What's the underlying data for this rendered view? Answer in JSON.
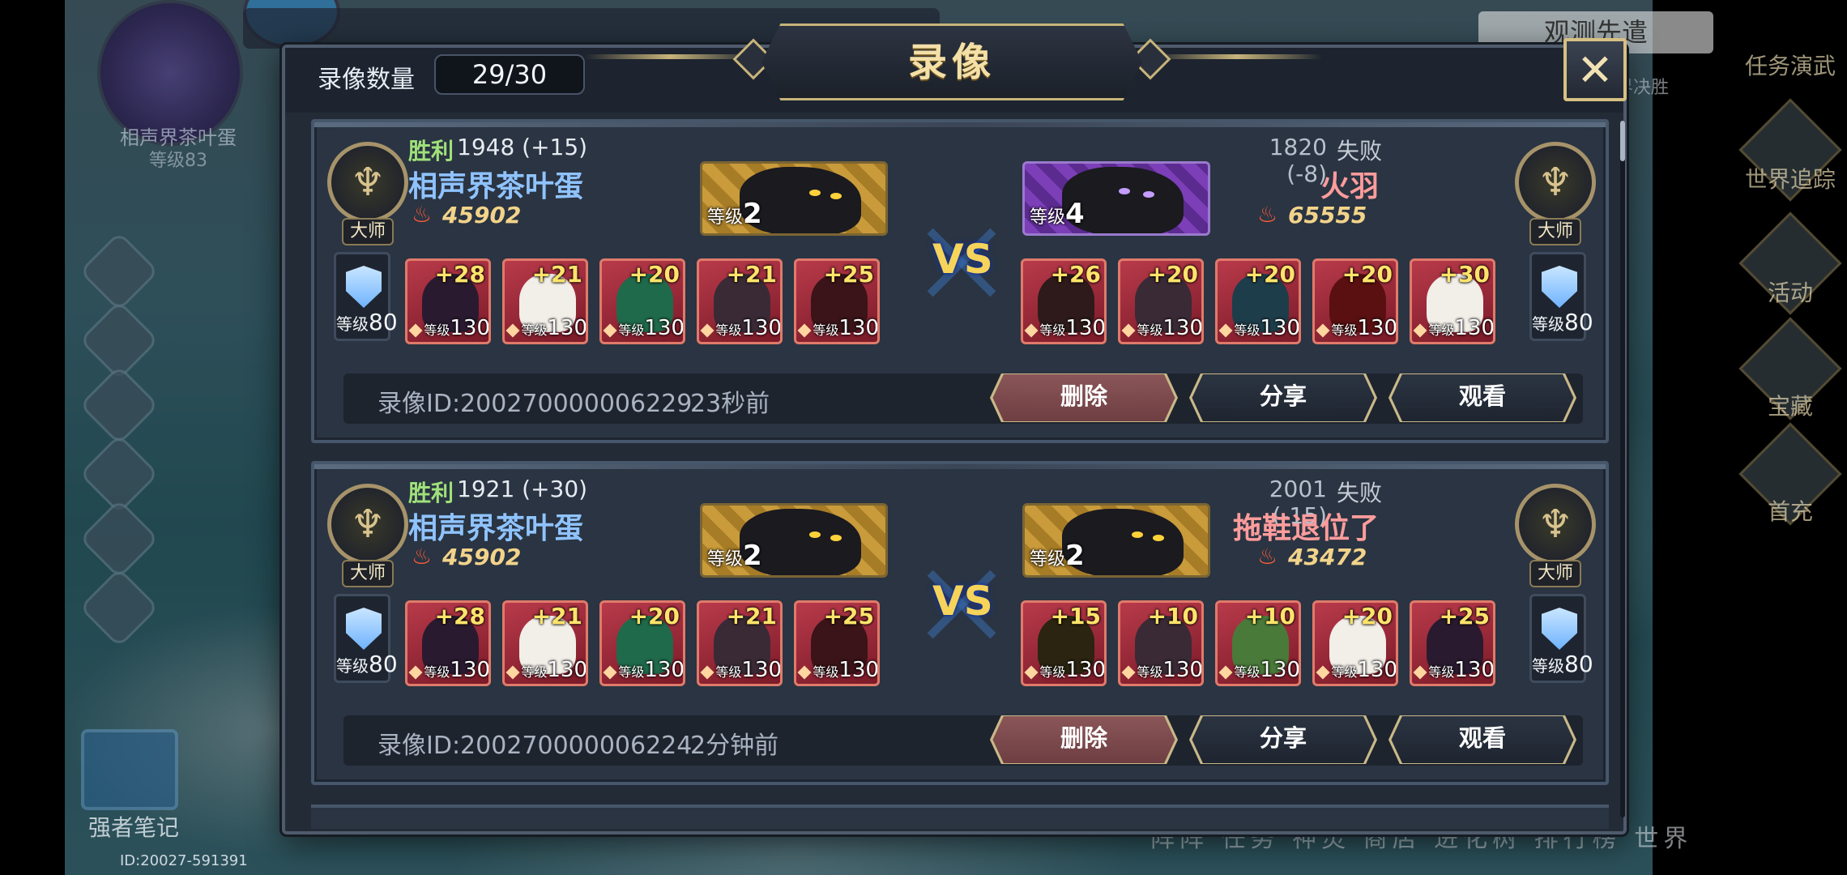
{
  "background": {
    "player_name": "相声界茶叶蛋",
    "player_sub": "等级83",
    "note_label": "强者笔记",
    "uid": "ID:20027-591391",
    "search_text": "观测先遣",
    "search_sub": "古世界决胜",
    "right_items": [
      "任务演武",
      "世界追踪",
      "活动",
      "宝藏",
      "首充"
    ],
    "bottom_nav": "阵阵  任务  神灵  商店  进化树  排行榜  世界"
  },
  "modal": {
    "title": "录像",
    "count_label": "录像数量",
    "count_value": "29/30",
    "close_icon": "close-x-icon",
    "accent_gold": "#c8b47a"
  },
  "records": [
    {
      "left": {
        "result": "胜利",
        "score": "1948 (+15)",
        "name": "相声界茶叶蛋",
        "power": "45902",
        "rank": "大师",
        "pet_level_label": "等级",
        "pet_level": "2",
        "pet_style": "gold",
        "shield_level_label": "等级",
        "shield_level": "80",
        "heroes": [
          {
            "plus": "+28",
            "level_label": "等级",
            "level": "130"
          },
          {
            "plus": "+21",
            "level_label": "等级",
            "level": "130"
          },
          {
            "plus": "+20",
            "level_label": "等级",
            "level": "130"
          },
          {
            "plus": "+21",
            "level_label": "等级",
            "level": "130"
          },
          {
            "plus": "+25",
            "level_label": "等级",
            "level": "130"
          }
        ]
      },
      "right": {
        "result": "失败",
        "score": "1820 (-8)",
        "name": "火羽",
        "power": "65555",
        "rank": "大师",
        "pet_level_label": "等级",
        "pet_level": "4",
        "pet_style": "purple",
        "shield_level_label": "等级",
        "shield_level": "80",
        "heroes": [
          {
            "plus": "+26",
            "level_label": "等级",
            "level": "130"
          },
          {
            "plus": "+20",
            "level_label": "等级",
            "level": "130"
          },
          {
            "plus": "+20",
            "level_label": "等级",
            "level": "130"
          },
          {
            "plus": "+20",
            "level_label": "等级",
            "level": "130"
          },
          {
            "plus": "+30",
            "level_label": "等级",
            "level": "130"
          }
        ]
      },
      "vs": "VS",
      "record_id": "录像ID:200270000006229",
      "time_ago": "23秒前",
      "delete_label": "删除",
      "share_label": "分享",
      "watch_label": "观看"
    },
    {
      "left": {
        "result": "胜利",
        "score": "1921 (+30)",
        "name": "相声界茶叶蛋",
        "power": "45902",
        "rank": "大师",
        "pet_level_label": "等级",
        "pet_level": "2",
        "pet_style": "gold",
        "shield_level_label": "等级",
        "shield_level": "80",
        "heroes": [
          {
            "plus": "+28",
            "level_label": "等级",
            "level": "130"
          },
          {
            "plus": "+21",
            "level_label": "等级",
            "level": "130"
          },
          {
            "plus": "+20",
            "level_label": "等级",
            "level": "130"
          },
          {
            "plus": "+21",
            "level_label": "等级",
            "level": "130"
          },
          {
            "plus": "+25",
            "level_label": "等级",
            "level": "130"
          }
        ]
      },
      "right": {
        "result": "失败",
        "score": "2001 (-15)",
        "name": "拖鞋退位了",
        "power": "43472",
        "rank": "大师",
        "pet_level_label": "等级",
        "pet_level": "2",
        "pet_style": "gold",
        "shield_level_label": "等级",
        "shield_level": "80",
        "heroes": [
          {
            "plus": "+15",
            "level_label": "等级",
            "level": "130"
          },
          {
            "plus": "+10",
            "level_label": "等级",
            "level": "130"
          },
          {
            "plus": "+10",
            "level_label": "等级",
            "level": "130"
          },
          {
            "plus": "+20",
            "level_label": "等级",
            "level": "130"
          },
          {
            "plus": "+25",
            "level_label": "等级",
            "level": "130"
          }
        ]
      },
      "vs": "VS",
      "record_id": "录像ID:200270000006224",
      "time_ago": "2分钟前",
      "delete_label": "删除",
      "share_label": "分享",
      "watch_label": "观看"
    }
  ]
}
